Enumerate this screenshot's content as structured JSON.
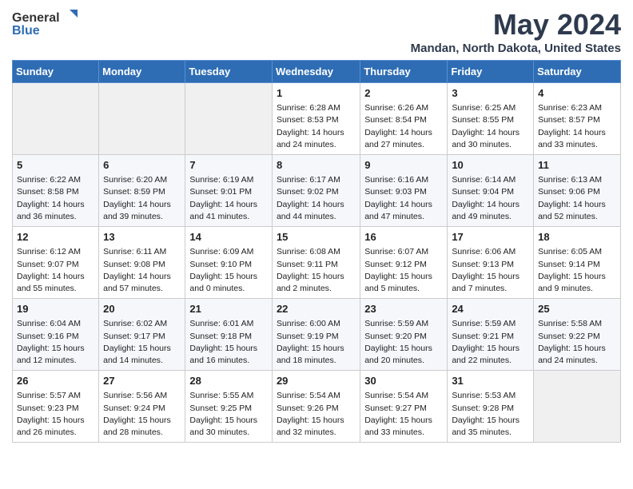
{
  "logo": {
    "general": "General",
    "blue": "Blue"
  },
  "title": {
    "month": "May 2024",
    "location": "Mandan, North Dakota, United States"
  },
  "weekdays": [
    "Sunday",
    "Monday",
    "Tuesday",
    "Wednesday",
    "Thursday",
    "Friday",
    "Saturday"
  ],
  "weeks": [
    [
      {
        "day": "",
        "info": ""
      },
      {
        "day": "",
        "info": ""
      },
      {
        "day": "",
        "info": ""
      },
      {
        "day": "1",
        "info": "Sunrise: 6:28 AM\nSunset: 8:53 PM\nDaylight: 14 hours\nand 24 minutes."
      },
      {
        "day": "2",
        "info": "Sunrise: 6:26 AM\nSunset: 8:54 PM\nDaylight: 14 hours\nand 27 minutes."
      },
      {
        "day": "3",
        "info": "Sunrise: 6:25 AM\nSunset: 8:55 PM\nDaylight: 14 hours\nand 30 minutes."
      },
      {
        "day": "4",
        "info": "Sunrise: 6:23 AM\nSunset: 8:57 PM\nDaylight: 14 hours\nand 33 minutes."
      }
    ],
    [
      {
        "day": "5",
        "info": "Sunrise: 6:22 AM\nSunset: 8:58 PM\nDaylight: 14 hours\nand 36 minutes."
      },
      {
        "day": "6",
        "info": "Sunrise: 6:20 AM\nSunset: 8:59 PM\nDaylight: 14 hours\nand 39 minutes."
      },
      {
        "day": "7",
        "info": "Sunrise: 6:19 AM\nSunset: 9:01 PM\nDaylight: 14 hours\nand 41 minutes."
      },
      {
        "day": "8",
        "info": "Sunrise: 6:17 AM\nSunset: 9:02 PM\nDaylight: 14 hours\nand 44 minutes."
      },
      {
        "day": "9",
        "info": "Sunrise: 6:16 AM\nSunset: 9:03 PM\nDaylight: 14 hours\nand 47 minutes."
      },
      {
        "day": "10",
        "info": "Sunrise: 6:14 AM\nSunset: 9:04 PM\nDaylight: 14 hours\nand 49 minutes."
      },
      {
        "day": "11",
        "info": "Sunrise: 6:13 AM\nSunset: 9:06 PM\nDaylight: 14 hours\nand 52 minutes."
      }
    ],
    [
      {
        "day": "12",
        "info": "Sunrise: 6:12 AM\nSunset: 9:07 PM\nDaylight: 14 hours\nand 55 minutes."
      },
      {
        "day": "13",
        "info": "Sunrise: 6:11 AM\nSunset: 9:08 PM\nDaylight: 14 hours\nand 57 minutes."
      },
      {
        "day": "14",
        "info": "Sunrise: 6:09 AM\nSunset: 9:10 PM\nDaylight: 15 hours\nand 0 minutes."
      },
      {
        "day": "15",
        "info": "Sunrise: 6:08 AM\nSunset: 9:11 PM\nDaylight: 15 hours\nand 2 minutes."
      },
      {
        "day": "16",
        "info": "Sunrise: 6:07 AM\nSunset: 9:12 PM\nDaylight: 15 hours\nand 5 minutes."
      },
      {
        "day": "17",
        "info": "Sunrise: 6:06 AM\nSunset: 9:13 PM\nDaylight: 15 hours\nand 7 minutes."
      },
      {
        "day": "18",
        "info": "Sunrise: 6:05 AM\nSunset: 9:14 PM\nDaylight: 15 hours\nand 9 minutes."
      }
    ],
    [
      {
        "day": "19",
        "info": "Sunrise: 6:04 AM\nSunset: 9:16 PM\nDaylight: 15 hours\nand 12 minutes."
      },
      {
        "day": "20",
        "info": "Sunrise: 6:02 AM\nSunset: 9:17 PM\nDaylight: 15 hours\nand 14 minutes."
      },
      {
        "day": "21",
        "info": "Sunrise: 6:01 AM\nSunset: 9:18 PM\nDaylight: 15 hours\nand 16 minutes."
      },
      {
        "day": "22",
        "info": "Sunrise: 6:00 AM\nSunset: 9:19 PM\nDaylight: 15 hours\nand 18 minutes."
      },
      {
        "day": "23",
        "info": "Sunrise: 5:59 AM\nSunset: 9:20 PM\nDaylight: 15 hours\nand 20 minutes."
      },
      {
        "day": "24",
        "info": "Sunrise: 5:59 AM\nSunset: 9:21 PM\nDaylight: 15 hours\nand 22 minutes."
      },
      {
        "day": "25",
        "info": "Sunrise: 5:58 AM\nSunset: 9:22 PM\nDaylight: 15 hours\nand 24 minutes."
      }
    ],
    [
      {
        "day": "26",
        "info": "Sunrise: 5:57 AM\nSunset: 9:23 PM\nDaylight: 15 hours\nand 26 minutes."
      },
      {
        "day": "27",
        "info": "Sunrise: 5:56 AM\nSunset: 9:24 PM\nDaylight: 15 hours\nand 28 minutes."
      },
      {
        "day": "28",
        "info": "Sunrise: 5:55 AM\nSunset: 9:25 PM\nDaylight: 15 hours\nand 30 minutes."
      },
      {
        "day": "29",
        "info": "Sunrise: 5:54 AM\nSunset: 9:26 PM\nDaylight: 15 hours\nand 32 minutes."
      },
      {
        "day": "30",
        "info": "Sunrise: 5:54 AM\nSunset: 9:27 PM\nDaylight: 15 hours\nand 33 minutes."
      },
      {
        "day": "31",
        "info": "Sunrise: 5:53 AM\nSunset: 9:28 PM\nDaylight: 15 hours\nand 35 minutes."
      },
      {
        "day": "",
        "info": ""
      }
    ]
  ]
}
